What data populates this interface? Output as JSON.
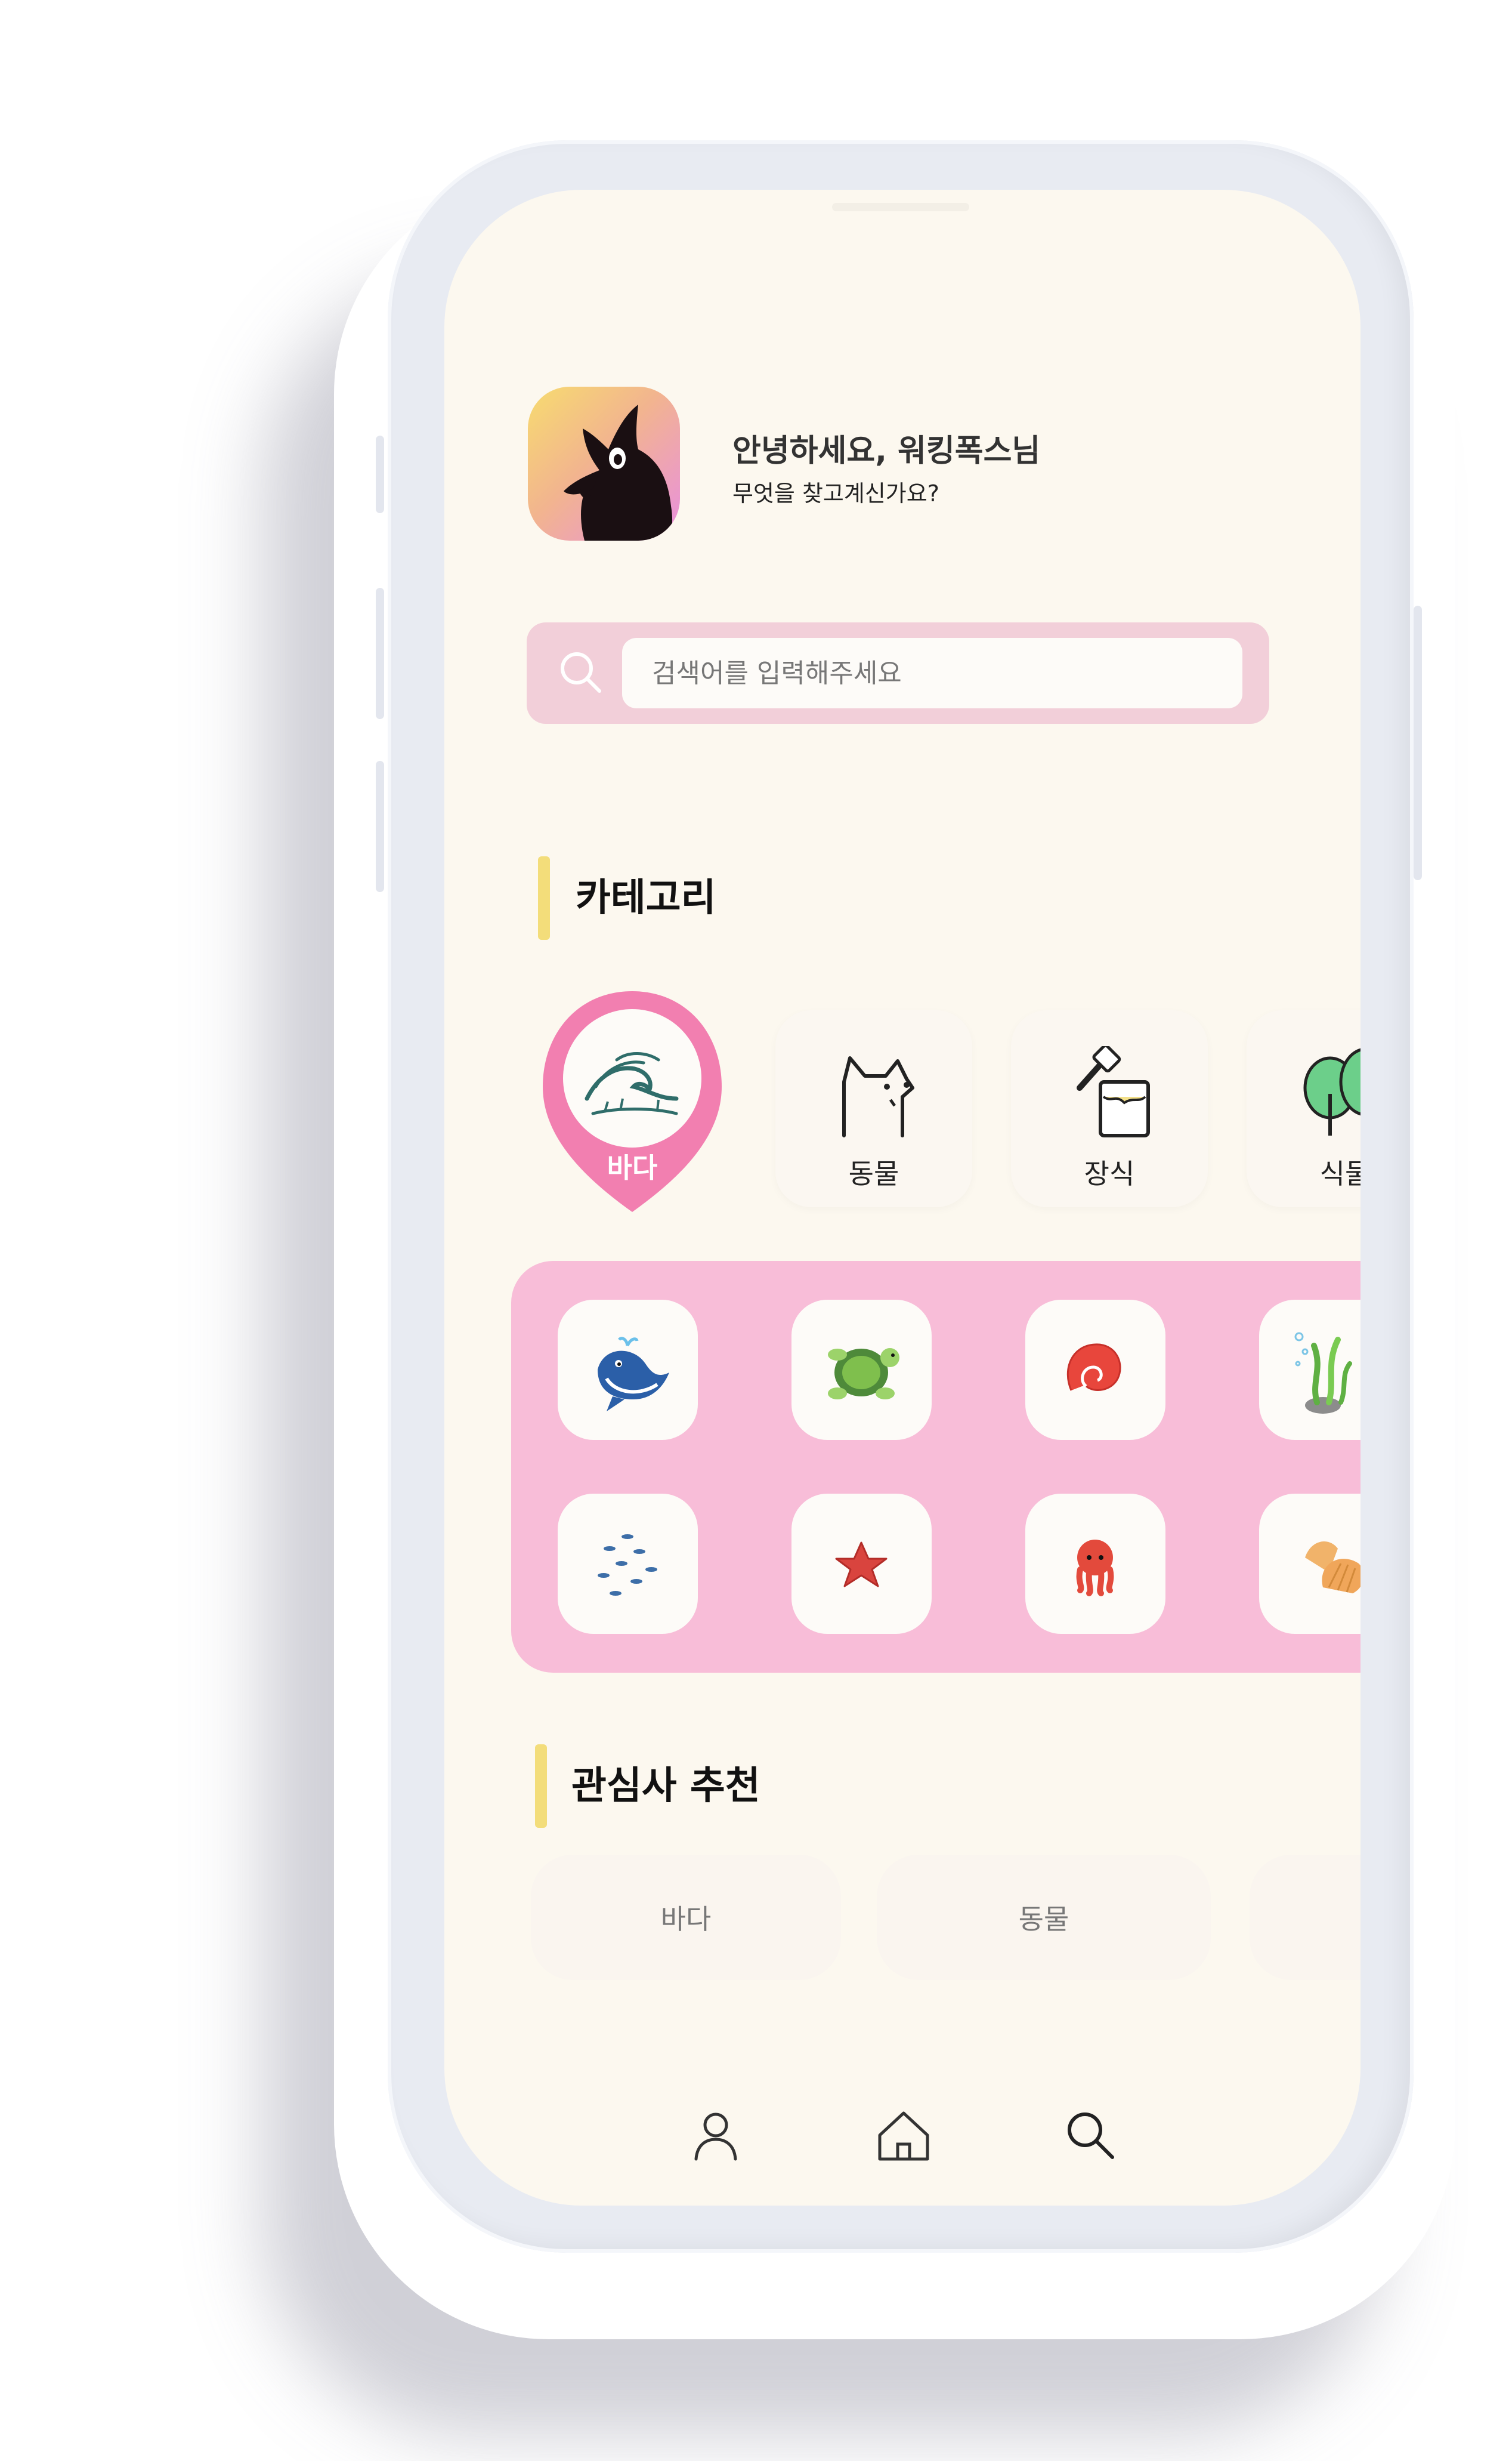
{
  "header": {
    "greeting": "안녕하세요, 워킹폭스님",
    "subtitle": "무엇을 찾고계신가요?"
  },
  "search": {
    "placeholder": "검색어를 입력해주세요"
  },
  "categories": {
    "title": "카테고리",
    "items": [
      {
        "label": "바다",
        "icon": "wave-icon",
        "selected": true
      },
      {
        "label": "동물",
        "icon": "dog-icon",
        "selected": false
      },
      {
        "label": "장식",
        "icon": "paint-bucket-icon",
        "selected": false
      },
      {
        "label": "식물",
        "icon": "trees-icon",
        "selected": false
      }
    ]
  },
  "sea_items": [
    {
      "icon": "whale-icon"
    },
    {
      "icon": "turtle-icon"
    },
    {
      "icon": "shell-icon"
    },
    {
      "icon": "seaweed-icon"
    },
    {
      "icon": "fish-school-icon"
    },
    {
      "icon": "starfish-icon"
    },
    {
      "icon": "octopus-icon"
    },
    {
      "icon": "scallop-icon"
    }
  ],
  "recommend": {
    "title": "관심사 추천",
    "chips": [
      "바다",
      "동물",
      ""
    ]
  },
  "tabbar": [
    {
      "icon": "user-icon"
    },
    {
      "icon": "home-icon"
    },
    {
      "icon": "search-icon"
    }
  ],
  "colors": {
    "screen_bg": "#fcf8ef",
    "accent_pink": "#f27fb0",
    "panel_pink": "#f8bdd8",
    "search_bg": "#f2cfd9",
    "section_bar": "#f3dd7a"
  }
}
